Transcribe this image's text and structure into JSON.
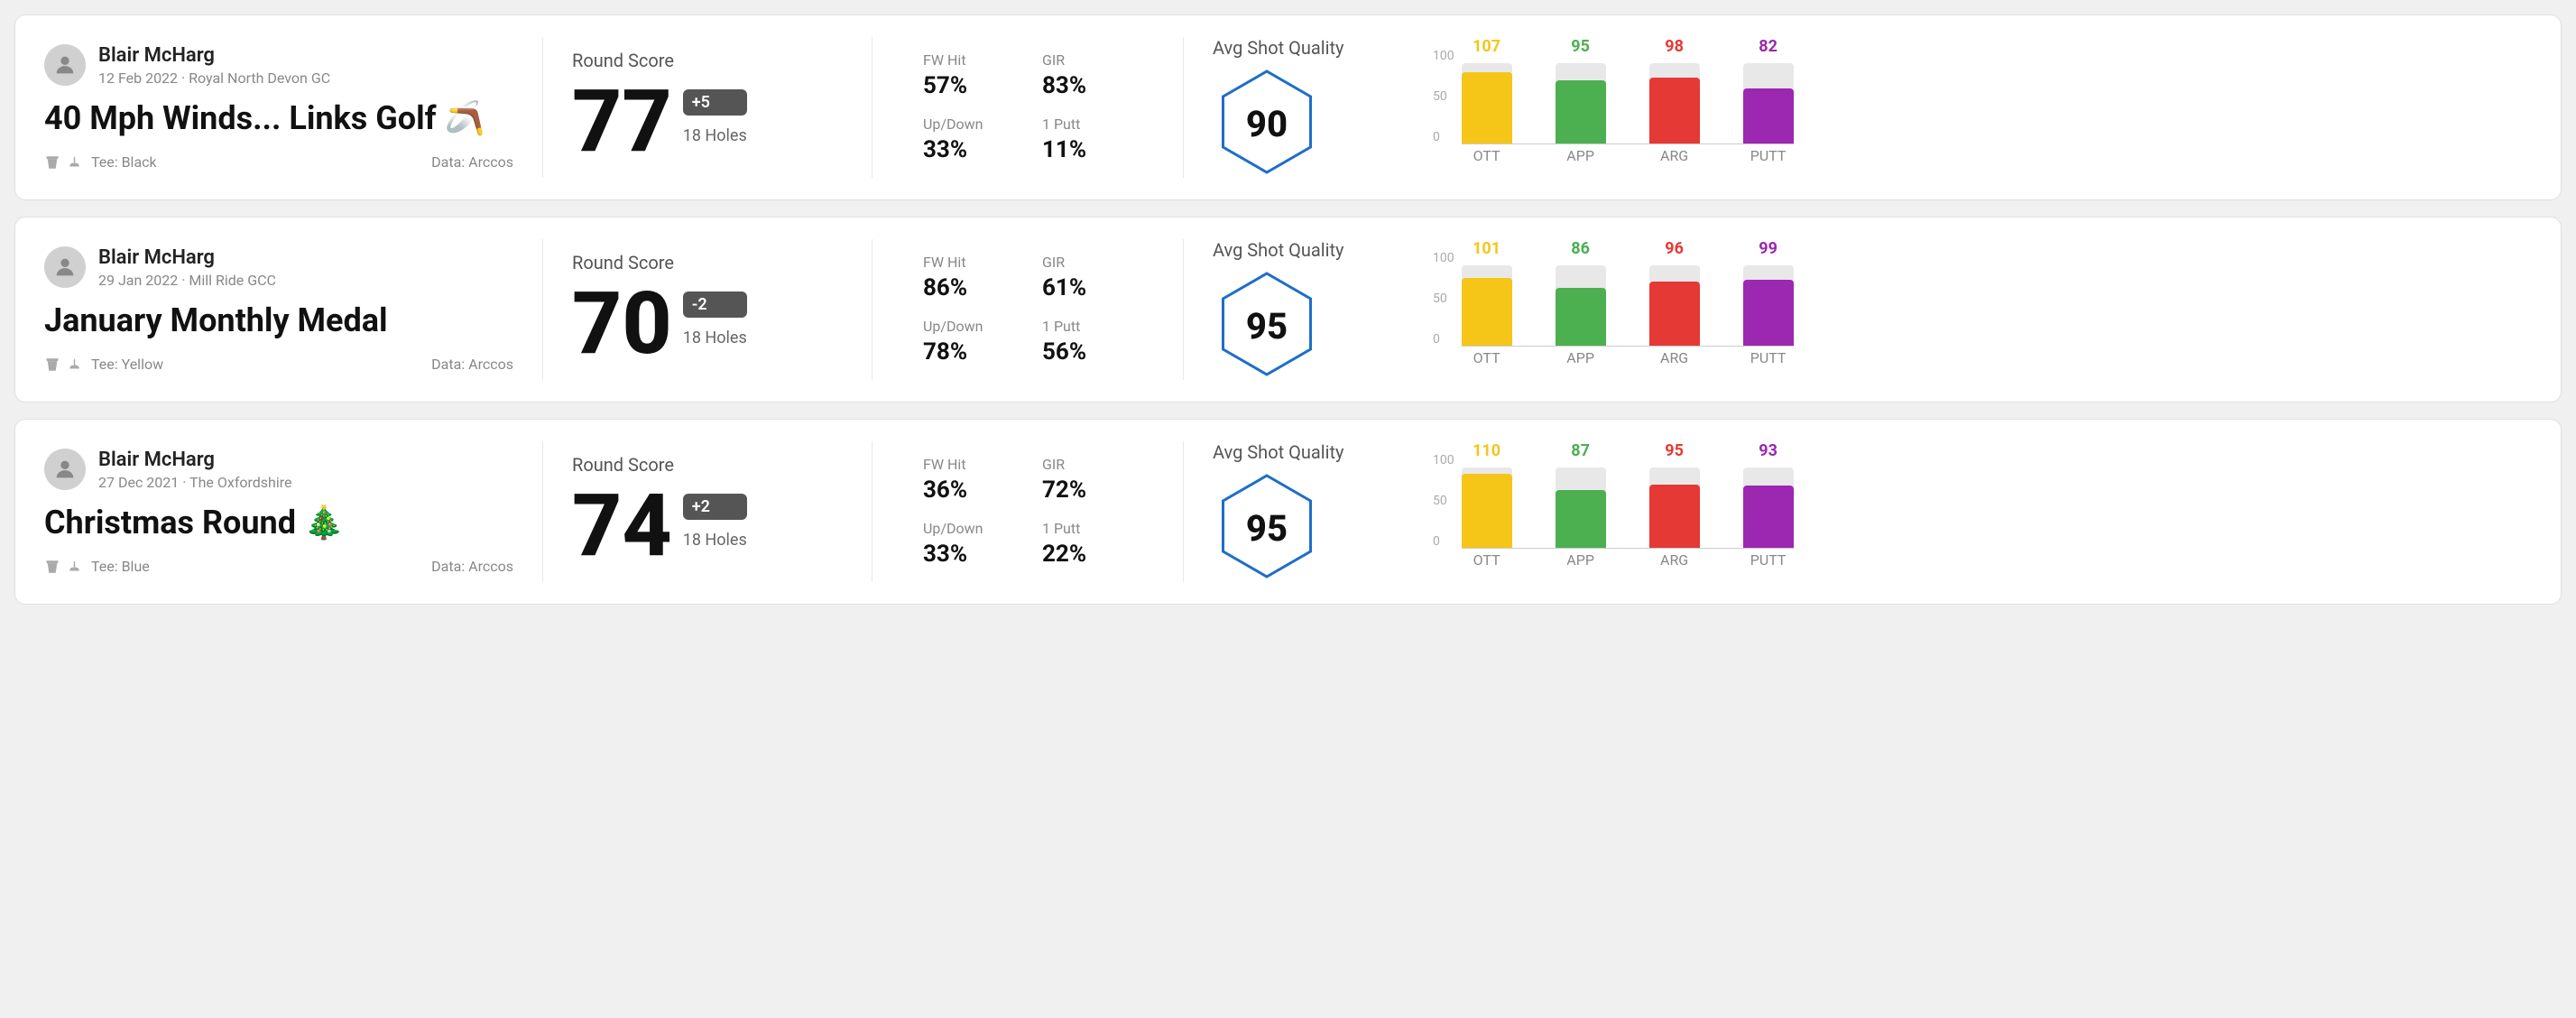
{
  "rounds": [
    {
      "id": "round1",
      "user": {
        "name": "Blair McHarg",
        "date": "12 Feb 2022 · Royal North Devon GC"
      },
      "title": "40 Mph Winds... Links Golf 🪃",
      "tee": "Black",
      "data_source": "Arccos",
      "score": {
        "value": "77",
        "badge": "+5",
        "holes": "18 Holes"
      },
      "stats": {
        "fw_hit_label": "FW Hit",
        "fw_hit_value": "57%",
        "gir_label": "GIR",
        "gir_value": "83%",
        "up_down_label": "Up/Down",
        "up_down_value": "33%",
        "one_putt_label": "1 Putt",
        "one_putt_value": "11%"
      },
      "quality": {
        "label": "Avg Shot Quality",
        "score": "90"
      },
      "chart": {
        "bars": [
          {
            "label": "OTT",
            "value": 107,
            "color": "#f5c518",
            "bg_height": 90,
            "fill_height": 4
          },
          {
            "label": "APP",
            "value": 95,
            "color": "#4caf50",
            "bg_height": 90,
            "fill_height": 4
          },
          {
            "label": "ARG",
            "value": 98,
            "color": "#e53935",
            "bg_height": 90,
            "fill_height": 4
          },
          {
            "label": "PUTT",
            "value": 82,
            "color": "#9c27b0",
            "bg_height": 90,
            "fill_height": 4
          }
        ],
        "y_labels": [
          "100",
          "50",
          "0"
        ]
      }
    },
    {
      "id": "round2",
      "user": {
        "name": "Blair McHarg",
        "date": "29 Jan 2022 · Mill Ride GCC"
      },
      "title": "January Monthly Medal",
      "tee": "Yellow",
      "data_source": "Arccos",
      "score": {
        "value": "70",
        "badge": "-2",
        "holes": "18 Holes"
      },
      "stats": {
        "fw_hit_label": "FW Hit",
        "fw_hit_value": "86%",
        "gir_label": "GIR",
        "gir_value": "61%",
        "up_down_label": "Up/Down",
        "up_down_value": "78%",
        "one_putt_label": "1 Putt",
        "one_putt_value": "56%"
      },
      "quality": {
        "label": "Avg Shot Quality",
        "score": "95"
      },
      "chart": {
        "bars": [
          {
            "label": "OTT",
            "value": 101,
            "color": "#f5c518",
            "bg_height": 90,
            "fill_height": 4
          },
          {
            "label": "APP",
            "value": 86,
            "color": "#4caf50",
            "bg_height": 90,
            "fill_height": 4
          },
          {
            "label": "ARG",
            "value": 96,
            "color": "#e53935",
            "bg_height": 90,
            "fill_height": 4
          },
          {
            "label": "PUTT",
            "value": 99,
            "color": "#9c27b0",
            "bg_height": 90,
            "fill_height": 4
          }
        ],
        "y_labels": [
          "100",
          "50",
          "0"
        ]
      }
    },
    {
      "id": "round3",
      "user": {
        "name": "Blair McHarg",
        "date": "27 Dec 2021 · The Oxfordshire"
      },
      "title": "Christmas Round 🎄",
      "tee": "Blue",
      "data_source": "Arccos",
      "score": {
        "value": "74",
        "badge": "+2",
        "holes": "18 Holes"
      },
      "stats": {
        "fw_hit_label": "FW Hit",
        "fw_hit_value": "36%",
        "gir_label": "GIR",
        "gir_value": "72%",
        "up_down_label": "Up/Down",
        "up_down_value": "33%",
        "one_putt_label": "1 Putt",
        "one_putt_value": "22%"
      },
      "quality": {
        "label": "Avg Shot Quality",
        "score": "95"
      },
      "chart": {
        "bars": [
          {
            "label": "OTT",
            "value": 110,
            "color": "#f5c518",
            "bg_height": 90,
            "fill_height": 4
          },
          {
            "label": "APP",
            "value": 87,
            "color": "#4caf50",
            "bg_height": 90,
            "fill_height": 4
          },
          {
            "label": "ARG",
            "value": 95,
            "color": "#e53935",
            "bg_height": 90,
            "fill_height": 4
          },
          {
            "label": "PUTT",
            "value": 93,
            "color": "#9c27b0",
            "bg_height": 90,
            "fill_height": 4
          }
        ],
        "y_labels": [
          "100",
          "50",
          "0"
        ]
      }
    }
  ]
}
